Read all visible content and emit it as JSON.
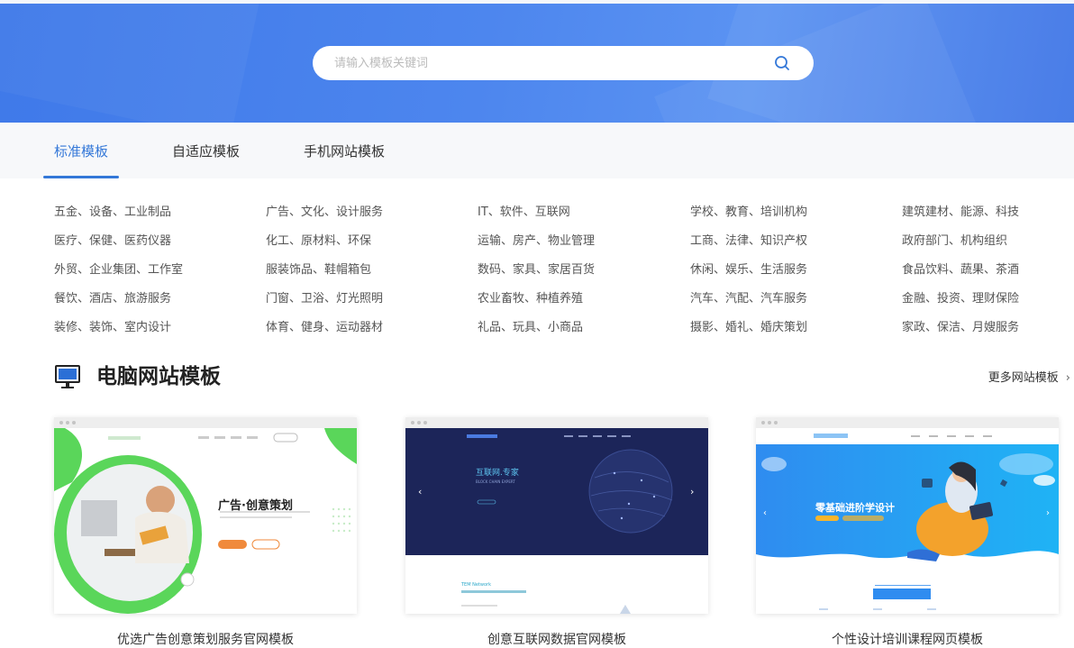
{
  "search": {
    "placeholder": "请输入模板关键词"
  },
  "tabs": [
    "标准模板",
    "自适应模板",
    "手机网站模板"
  ],
  "categories": [
    [
      "五金、设备、工业制品",
      "医疗、保健、医药仪器",
      "外贸、企业集团、工作室",
      "餐饮、酒店、旅游服务",
      "装修、装饰、室内设计"
    ],
    [
      "广告、文化、设计服务",
      "化工、原材料、环保",
      "服装饰品、鞋帽箱包",
      "门窗、卫浴、灯光照明",
      "体育、健身、运动器材"
    ],
    [
      "IT、软件、互联网",
      "运输、房产、物业管理",
      "数码、家具、家居百货",
      "农业畜牧、种植养殖",
      "礼品、玩具、小商品"
    ],
    [
      "学校、教育、培训机构",
      "工商、法律、知识产权",
      "休闲、娱乐、生活服务",
      "汽车、汽配、汽车服务",
      "摄影、婚礼、婚庆策划"
    ],
    [
      "建筑建材、能源、科技",
      "政府部门、机构组织",
      "食品饮料、蔬果、茶酒",
      "金融、投资、理财保险",
      "家政、保洁、月嫂服务"
    ]
  ],
  "section": {
    "title": "电脑网站模板",
    "more": "更多网站模板",
    "more_chevron": "›"
  },
  "templates": [
    {
      "name": "优选广告创意策划服务官网模板",
      "headline": "广告·创意策划"
    },
    {
      "name": "创意互联网数据官网模板",
      "headline": "互联网.专家",
      "subline": "BLOCK CHAIN EXPERT",
      "footer_title": "TEM Network"
    },
    {
      "name": "个性设计培训课程网页模板",
      "headline": "零基础进阶学设计"
    }
  ],
  "colors": {
    "accent": "#3478d8",
    "hero": "#4d86ee",
    "green": "#5ad65a",
    "navy": "#1c2559"
  }
}
